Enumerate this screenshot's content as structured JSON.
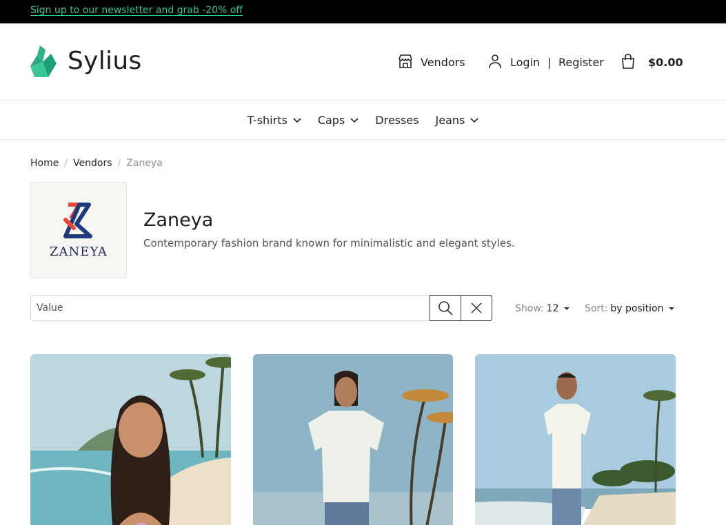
{
  "announcement": {
    "text": "Sign up to our newsletter and grab -20% off"
  },
  "brand": {
    "name": "Sylius",
    "accent": "#2bb68a"
  },
  "header_nav": {
    "vendors_label": "Vendors",
    "login_label": "Login",
    "separator": "|",
    "register_label": "Register",
    "cart_total": "$0.00"
  },
  "menu": [
    {
      "label": "T-shirts",
      "dropdown": true
    },
    {
      "label": "Caps",
      "dropdown": true
    },
    {
      "label": "Dresses",
      "dropdown": false
    },
    {
      "label": "Jeans",
      "dropdown": true
    }
  ],
  "breadcrumb": {
    "home": "Home",
    "vendors": "Vendors",
    "current": "Zaneya"
  },
  "vendor": {
    "name": "Zaneya",
    "description": "Contemporary fashion brand known for minimalistic and elegant styles.",
    "logo_text": "ZANEYA"
  },
  "search": {
    "placeholder": "Value"
  },
  "listing": {
    "show_label": "Show:",
    "show_value": "12",
    "sort_label": "Sort:",
    "sort_value": "by position"
  },
  "products": [
    {
      "icon": "product-image-woman-beach"
    },
    {
      "icon": "product-image-man-white-tshirt-palms"
    },
    {
      "icon": "product-image-man-white-tshirt-beach"
    }
  ]
}
